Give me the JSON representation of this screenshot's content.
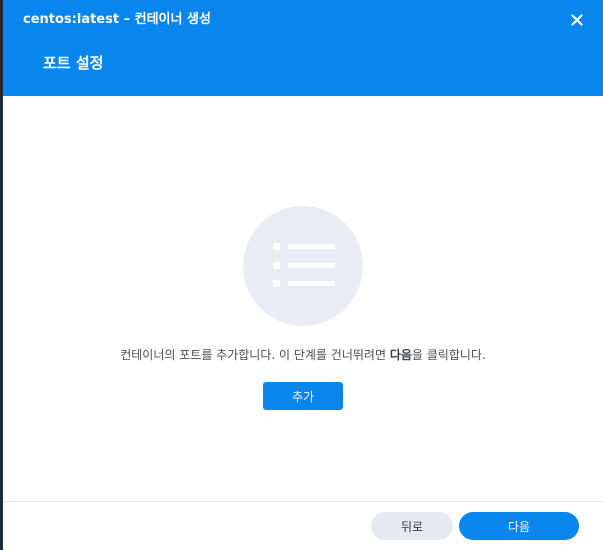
{
  "window": {
    "title": "centos:latest – 컨테이너 생성",
    "close_icon": "close-icon"
  },
  "step": {
    "title": "포트 설정"
  },
  "empty_state": {
    "icon": "list-icon",
    "message_before": "컨테이너의 포트를 추가합니다. 이 단계를 건너뛰려면 ",
    "message_emphasis": "다음",
    "message_after": "을 클릭합니다.",
    "add_label": "추가"
  },
  "footer": {
    "back_label": "뒤로",
    "next_label": "다음"
  },
  "colors": {
    "accent": "#0986ee",
    "secondary_button": "#e6eaf0",
    "illustration_bg": "#e9edf3"
  }
}
